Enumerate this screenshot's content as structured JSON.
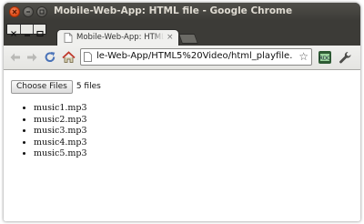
{
  "window": {
    "title": "Mobile-Web-App: HTML file - Google Chrome"
  },
  "tabs": [
    {
      "label": "Mobile-Web-App: HTML file"
    }
  ],
  "toolbar": {
    "url": "le-Web-App/HTML5%20Video/html_playfile.html"
  },
  "file_input": {
    "button_label": "Choose Files",
    "status": "5 files"
  },
  "files": [
    {
      "name": "music1.mp3"
    },
    {
      "name": "music2.mp3"
    },
    {
      "name": "music3.mp3"
    },
    {
      "name": "music4.mp3"
    },
    {
      "name": "music5.mp3"
    }
  ],
  "colors": {
    "titlebar": "#3c3b37",
    "close_button": "#dd4814",
    "title_text": "#dfdbd2"
  },
  "icons": {
    "back": "back-arrow-icon",
    "forward": "forward-arrow-icon",
    "reload": "reload-icon",
    "home": "home-icon",
    "star": "star-icon",
    "extension": "extension-icon",
    "wrench": "wrench-icon"
  }
}
